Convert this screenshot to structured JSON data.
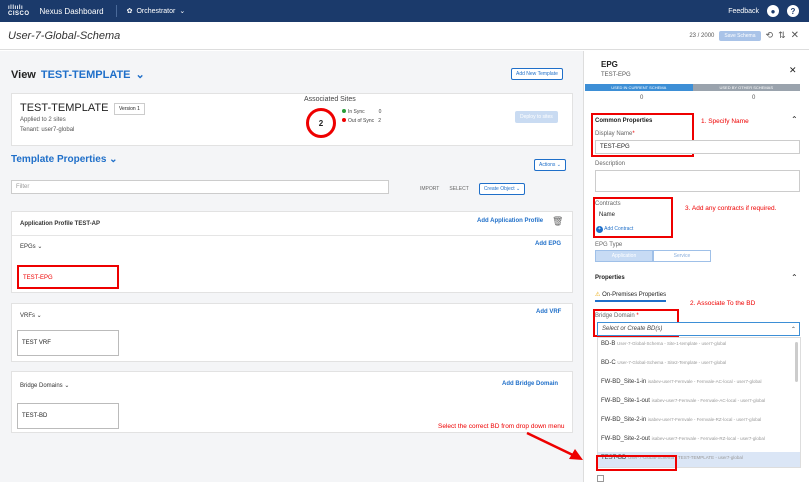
{
  "topbar": {
    "logo_line1": "ıllıılı",
    "logo_line2": "CISCO",
    "app_name": "Nexus Dashboard",
    "service": "Orchestrator",
    "feedback": "Feedback",
    "help": "?"
  },
  "subbar": {
    "schema_title": "User-7-Global-Schema",
    "counter": "23 / 2000",
    "save_label": "Save Schema"
  },
  "view": {
    "label": "View",
    "template_name": "TEST-TEMPLATE",
    "add_template": "Add New Template"
  },
  "template_card": {
    "name": "TEST-TEMPLATE",
    "version": "Version 1",
    "applied": "Applied to 2 sites",
    "tenant": "Tenant: user7-global",
    "assoc_title": "Associated Sites",
    "count": "2",
    "in_sync_label": "In Sync",
    "in_sync": "0",
    "out_sync_label": "Out of Sync",
    "out_sync": "2",
    "deploy": "Deploy to sites"
  },
  "props": {
    "title": "Template Properties",
    "actions": "Actions",
    "filter_placeholder": "Filter",
    "import": "IMPORT",
    "select": "SELECT",
    "create_object": "Create Object"
  },
  "ap": {
    "title": "Application Profile TEST-AP",
    "add": "Add Application Profile",
    "epgs_label": "EPGs",
    "add_epg": "Add EPG",
    "epg_name": "TEST-EPG"
  },
  "vrfs": {
    "label": "VRFs",
    "add": "Add VRF",
    "vrf_name": "TEST VRF"
  },
  "bds": {
    "label": "Bridge Domains",
    "add": "Add Bridge Domain",
    "bd_name": "TEST-BD"
  },
  "panel": {
    "title": "EPG",
    "subtitle": "TEST-EPG",
    "used_current": "USED IN CURRENT SCHEMA",
    "used_other": "USED BY OTHER SCHEMAS",
    "count_current": "0",
    "count_other": "0",
    "common": "Common Properties",
    "display_name_label": "Display Name",
    "display_name": "TEST-EPG",
    "description_label": "Description",
    "contracts_label": "Contracts",
    "contracts_col": "Name",
    "add_contract": "Add Contract",
    "epg_type_label": "EPG Type",
    "type_app": "Application",
    "type_service": "Service",
    "properties": "Properties",
    "onprem": "On-Premises Properties",
    "bd_label": "Bridge Domain",
    "bd_placeholder": "Select or Create BD(s)"
  },
  "dropdown": [
    {
      "name": "BD-B",
      "detail": "User-7-Global-Schema - Site-1-template - user7-global"
    },
    {
      "name": "BD-C",
      "detail": "User-7-Global-Schema - Site2-Template - user7-global"
    },
    {
      "name": "FW-BD_Site-1-in",
      "detail": "isabev-user7-Fernvale - Fernvale-AC-local - user7-global"
    },
    {
      "name": "FW-BD_Site-1-out",
      "detail": "isabev-user7-Fernvale - Fernvale-AC-local - user7-global"
    },
    {
      "name": "FW-BD_Site-2-in",
      "detail": "isabev-user7-Fernvale - Fernvale-RZ-local - user7-global"
    },
    {
      "name": "FW-BD_Site-2-out",
      "detail": "isabev-user7-Fernvale - Fernvale-RZ-local - user7-global"
    },
    {
      "name": "TEST-BD",
      "detail": "User-7-Global-Schema - TEST-TEMPLATE - user7-global"
    }
  ],
  "annotations": {
    "a1": "1.  Specify Name",
    "a2": "2.  Associate To the BD",
    "a3": "3.  Add any contracts if required.",
    "a4": "Select the correct BD from drop down menu"
  },
  "colors": {
    "topbar": "#1b3a6b",
    "accent": "#1f6fc9",
    "annotation": "#e00000"
  }
}
